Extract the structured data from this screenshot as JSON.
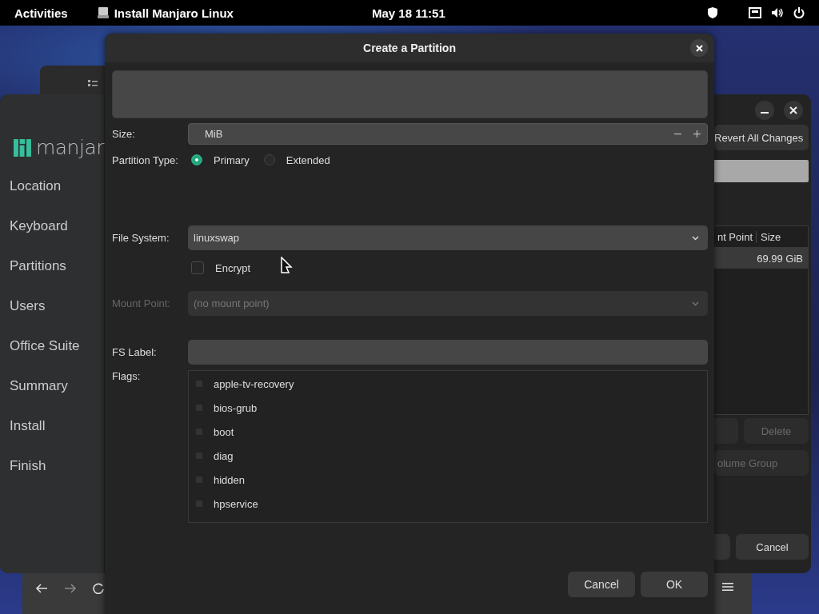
{
  "top_bar": {
    "activities": "Activities",
    "app_title": "Install Manjaro Linux",
    "clock": "May 18  11:51"
  },
  "installer": {
    "logo": "manjar",
    "steps": [
      "Location",
      "Keyboard",
      "Partitions",
      "Users",
      "Office Suite",
      "Summary",
      "Install",
      "Finish"
    ],
    "revert_button": "Revert All Changes",
    "table": {
      "columns": [
        "nt Point",
        "Size"
      ],
      "rows": [
        {
          "size": "69.99 GiB"
        }
      ]
    },
    "buttons": [
      {
        "label": "Delete",
        "disabled": true
      },
      {
        "label": "olume Group",
        "disabled": true
      }
    ],
    "cancel_button": "Cancel"
  },
  "dialog": {
    "title": "Create a Partition",
    "size": {
      "label": "Size:",
      "value": "MiB"
    },
    "partition_type": {
      "label": "Partition Type:",
      "options": [
        {
          "label": "Primary",
          "selected": true
        },
        {
          "label": "Extended",
          "selected": false
        }
      ]
    },
    "file_system": {
      "label": "File System:",
      "value": "linuxswap"
    },
    "encrypt": {
      "label": "Encrypt",
      "checked": false
    },
    "mount_point": {
      "label": "Mount Point:",
      "value": "(no mount point)",
      "disabled": true
    },
    "fs_label": {
      "label": "FS Label:"
    },
    "flags": {
      "label": "Flags:",
      "items": [
        {
          "label": "apple-tv-recovery",
          "checked": false
        },
        {
          "label": "bios-grub",
          "checked": false
        },
        {
          "label": "boot",
          "checked": false
        },
        {
          "label": "diag",
          "checked": false
        },
        {
          "label": "hidden",
          "checked": false
        },
        {
          "label": "hpservice",
          "checked": false
        }
      ]
    },
    "buttons": [
      "Cancel",
      "OK"
    ]
  }
}
